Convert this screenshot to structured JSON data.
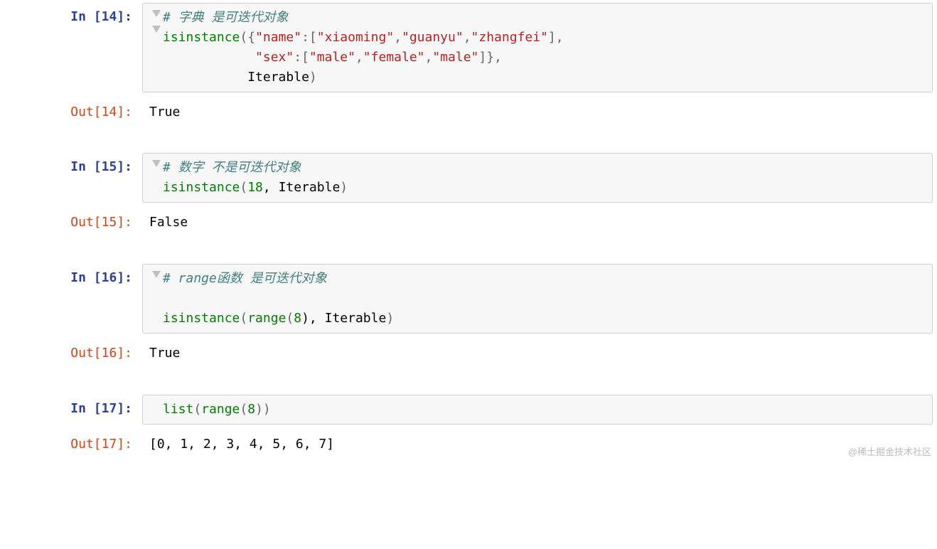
{
  "cells": [
    {
      "in_prompt": "In [14]:",
      "out_prompt": "Out[14]:",
      "arrows": 2,
      "code": {
        "lines": [
          [
            {
              "t": "# 字典 是可迭代对象",
              "c": "cm"
            }
          ],
          [
            {
              "t": "isinstance",
              "c": "fn"
            },
            {
              "t": "({",
              "c": "pn"
            },
            {
              "t": "\"name\"",
              "c": "st"
            },
            {
              "t": ":[",
              "c": "pn"
            },
            {
              "t": "\"xiaoming\"",
              "c": "st"
            },
            {
              "t": ",",
              "c": "pn"
            },
            {
              "t": "\"guanyu\"",
              "c": "st"
            },
            {
              "t": ",",
              "c": "pn"
            },
            {
              "t": "\"zhangfei\"",
              "c": "st"
            },
            {
              "t": "],",
              "c": "pn"
            }
          ],
          [
            {
              "t": "            ",
              "c": "id"
            },
            {
              "t": "\"sex\"",
              "c": "st"
            },
            {
              "t": ":[",
              "c": "pn"
            },
            {
              "t": "\"male\"",
              "c": "st"
            },
            {
              "t": ",",
              "c": "pn"
            },
            {
              "t": "\"female\"",
              "c": "st"
            },
            {
              "t": ",",
              "c": "pn"
            },
            {
              "t": "\"male\"",
              "c": "st"
            },
            {
              "t": "]},",
              "c": "pn"
            }
          ],
          [
            {
              "t": "           Iterable",
              "c": "id"
            },
            {
              "t": ")",
              "c": "pn"
            }
          ]
        ]
      },
      "output": "True"
    },
    {
      "in_prompt": "In [15]:",
      "out_prompt": "Out[15]:",
      "arrows": 1,
      "code": {
        "lines": [
          [
            {
              "t": "# 数字 不是可迭代对象",
              "c": "cm"
            }
          ],
          [
            {
              "t": "isinstance",
              "c": "fn"
            },
            {
              "t": "(",
              "c": "pn"
            },
            {
              "t": "18",
              "c": "nm"
            },
            {
              "t": ", Iterable",
              "c": "id"
            },
            {
              "t": ")",
              "c": "pn"
            }
          ]
        ]
      },
      "output": "False"
    },
    {
      "in_prompt": "In [16]:",
      "out_prompt": "Out[16]:",
      "arrows": 1,
      "code": {
        "lines": [
          [
            {
              "t": "# range函数 是可迭代对象",
              "c": "cm"
            }
          ],
          [
            {
              "t": "",
              "c": "id"
            }
          ],
          [
            {
              "t": "isinstance",
              "c": "fn"
            },
            {
              "t": "(",
              "c": "pn"
            },
            {
              "t": "range",
              "c": "fn"
            },
            {
              "t": "(",
              "c": "pn"
            },
            {
              "t": "8",
              "c": "nm"
            },
            {
              "t": "), Iterable",
              "c": "id"
            },
            {
              "t": ")",
              "c": "pn"
            }
          ]
        ]
      },
      "output": "True"
    },
    {
      "in_prompt": "In [17]:",
      "out_prompt": "Out[17]:",
      "arrows": 0,
      "code": {
        "lines": [
          [
            {
              "t": "list",
              "c": "fn"
            },
            {
              "t": "(",
              "c": "pn"
            },
            {
              "t": "range",
              "c": "fn"
            },
            {
              "t": "(",
              "c": "pn"
            },
            {
              "t": "8",
              "c": "nm"
            },
            {
              "t": "))",
              "c": "pn"
            }
          ]
        ]
      },
      "output": "[0, 1, 2, 3, 4, 5, 6, 7]"
    }
  ],
  "watermark": "@稀土掘金技术社区"
}
